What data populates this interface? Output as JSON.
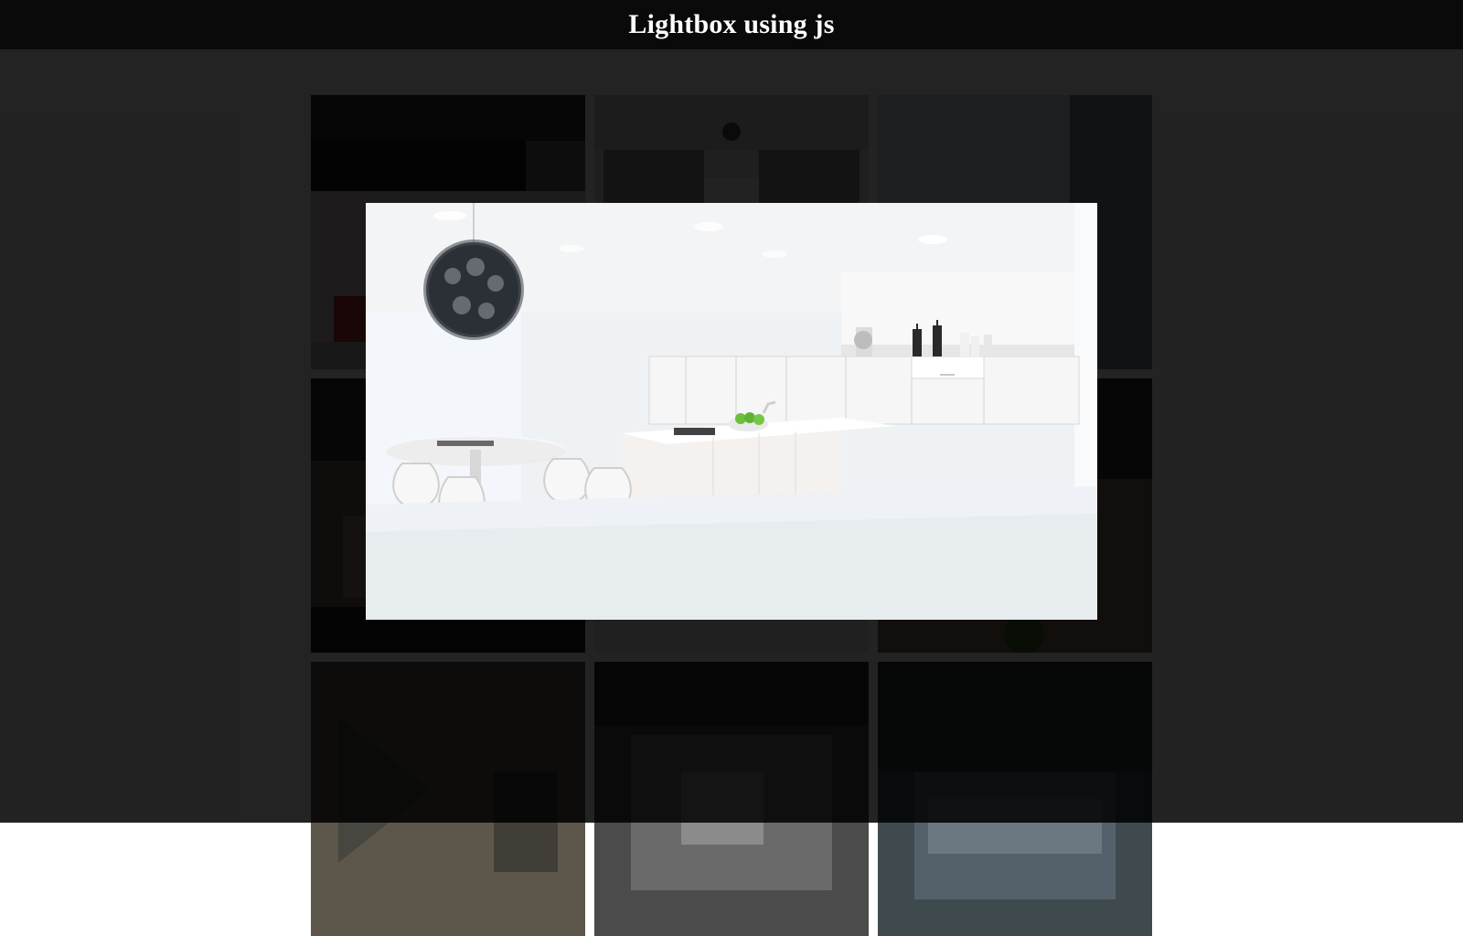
{
  "header": {
    "title": "Lightbox using js"
  },
  "gallery": {
    "thumbnails": [
      {
        "alt": ""
      },
      {
        "alt": ""
      },
      {
        "alt": ""
      },
      {
        "alt": ""
      },
      {
        "alt": ""
      },
      {
        "alt": ""
      },
      {
        "alt": ""
      },
      {
        "alt": ""
      },
      {
        "alt": ""
      }
    ]
  },
  "lightbox": {
    "visible": true,
    "image_alt": ""
  },
  "colors": {
    "header_bg": "#0a0a0a",
    "overlay": "rgba(0,0,0,0.86)",
    "page_bg": "#f4f4f4"
  }
}
